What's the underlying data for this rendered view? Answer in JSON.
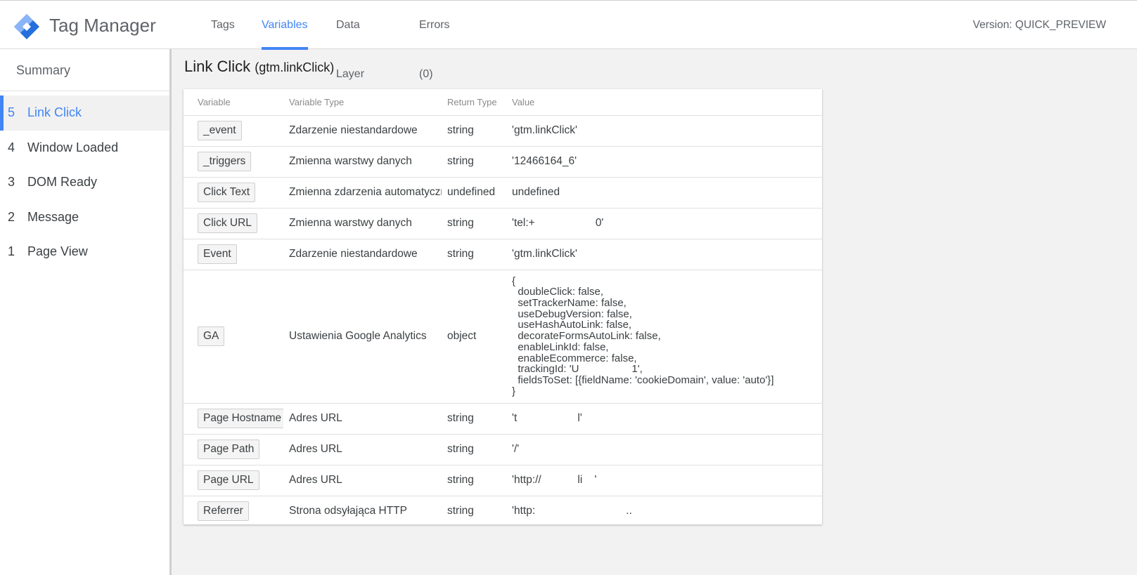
{
  "app": {
    "title": "Tag Manager",
    "version": "Version: QUICK_PREVIEW"
  },
  "nav": {
    "tabs": [
      "Tags",
      "Variables",
      "Data Layer",
      "Errors (0)"
    ],
    "active": "Variables"
  },
  "sidebar": {
    "summary": "Summary",
    "events": [
      {
        "num": "5",
        "label": "Link Click"
      },
      {
        "num": "4",
        "label": "Window Loaded"
      },
      {
        "num": "3",
        "label": "DOM Ready"
      },
      {
        "num": "2",
        "label": "Message"
      },
      {
        "num": "1",
        "label": "Page View"
      }
    ]
  },
  "main": {
    "title": "Link Click",
    "subtitle": "(gtm.linkClick)",
    "columns": [
      "Variable",
      "Variable Type",
      "Return Type",
      "Value"
    ],
    "rows": [
      {
        "variable": "_event",
        "type": "Zdarzenie niestandardowe",
        "return": "string",
        "value": "'gtm.linkClick'"
      },
      {
        "variable": "_triggers",
        "type": "Zmienna warstwy danych",
        "return": "string",
        "value": "'12466164_6'"
      },
      {
        "variable": "Click Text",
        "type": "Zmienna zdarzenia automatycznego",
        "return": "undefined",
        "value": "undefined"
      },
      {
        "variable": "Click URL",
        "type": "Zmienna warstwy danych",
        "return": "string",
        "value": "'tel:+                    0'"
      },
      {
        "variable": "Event",
        "type": "Zdarzenie niestandardowe",
        "return": "string",
        "value": "'gtm.linkClick'"
      },
      {
        "variable": "GA",
        "type": "Ustawienia Google Analytics",
        "return": "object",
        "value": "{\n  doubleClick: false,\n  setTrackerName: false,\n  useDebugVersion: false,\n  useHashAutoLink: false,\n  decorateFormsAutoLink: false,\n  enableLinkId: false,\n  enableEcommerce: false,\n  trackingId: 'U                  1',\n  fieldsToSet: [{fieldName: 'cookieDomain', value: 'auto'}]\n}"
      },
      {
        "variable": "Page Hostname",
        "type": "Adres URL",
        "return": "string",
        "value": "'t                    l'"
      },
      {
        "variable": "Page Path",
        "type": "Adres URL",
        "return": "string",
        "value": "'/'"
      },
      {
        "variable": "Page URL",
        "type": "Adres URL",
        "return": "string",
        "value": "'http://            li    '"
      },
      {
        "variable": "Referrer",
        "type": "Strona odsyłająca HTTP",
        "return": "string",
        "value": "'http:                              .."
      }
    ]
  },
  "colors": {
    "accent": "#4285f4",
    "logo_dark": "#246fdb",
    "logo_light": "#8ab4f8"
  }
}
